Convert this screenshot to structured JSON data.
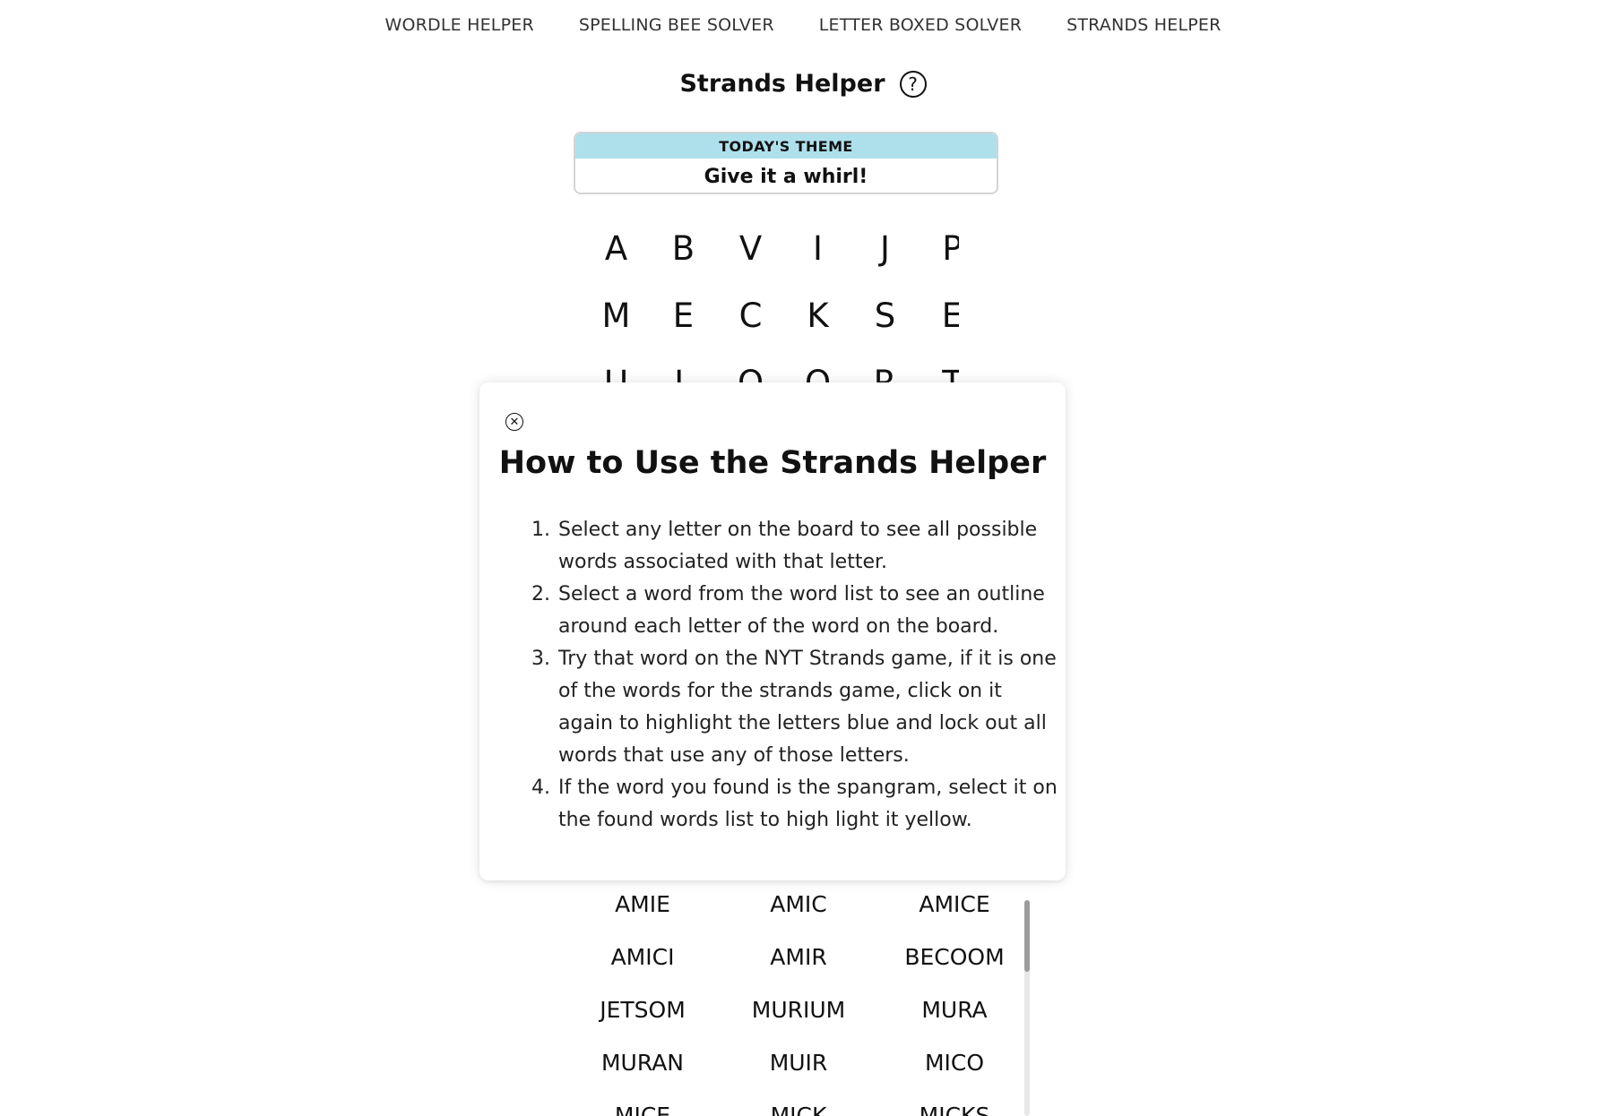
{
  "nav": {
    "items": [
      {
        "label": "WORDLE HELPER"
      },
      {
        "label": "SPELLING BEE SOLVER"
      },
      {
        "label": "LETTER BOXED SOLVER"
      },
      {
        "label": "STRANDS HELPER"
      }
    ]
  },
  "header": {
    "title": "Strands Helper",
    "help_icon": "question-circle-icon",
    "help_glyph": "?"
  },
  "theme": {
    "label": "TODAY'S THEME",
    "text": "Give it a whirl!",
    "header_color": "#aee0ec"
  },
  "board": {
    "rows": [
      [
        "A",
        "B",
        "V",
        "I",
        "J",
        "P"
      ],
      [
        "M",
        "E",
        "C",
        "K",
        "S",
        "E"
      ],
      [
        "U",
        "L",
        "O",
        "O",
        "R",
        "T"
      ]
    ]
  },
  "modal": {
    "close_icon": "close-circle-icon",
    "close_glyph": "✕",
    "title": "How to Use the Strands Helper",
    "steps": [
      "Select any letter on the board to see all possible words associated with that letter.",
      "Select a word from the word list to see an outline around each letter of the word on the board.",
      "Try that word on the NYT Strands game, if it is one of the words for the strands game, click on it again to highlight the letters blue and lock out all words that use any of those letters.",
      "If the word you found is the spangram, select it on the found words list to high light it yellow."
    ]
  },
  "word_list": {
    "words": [
      "AMIE",
      "AMIC",
      "AMICE",
      "AMICI",
      "AMIR",
      "BECOOM",
      "JETSOM",
      "MURIUM",
      "MURA",
      "MURAN",
      "MUIR",
      "MICO",
      "MICE",
      "MICK",
      "MICKS"
    ]
  }
}
